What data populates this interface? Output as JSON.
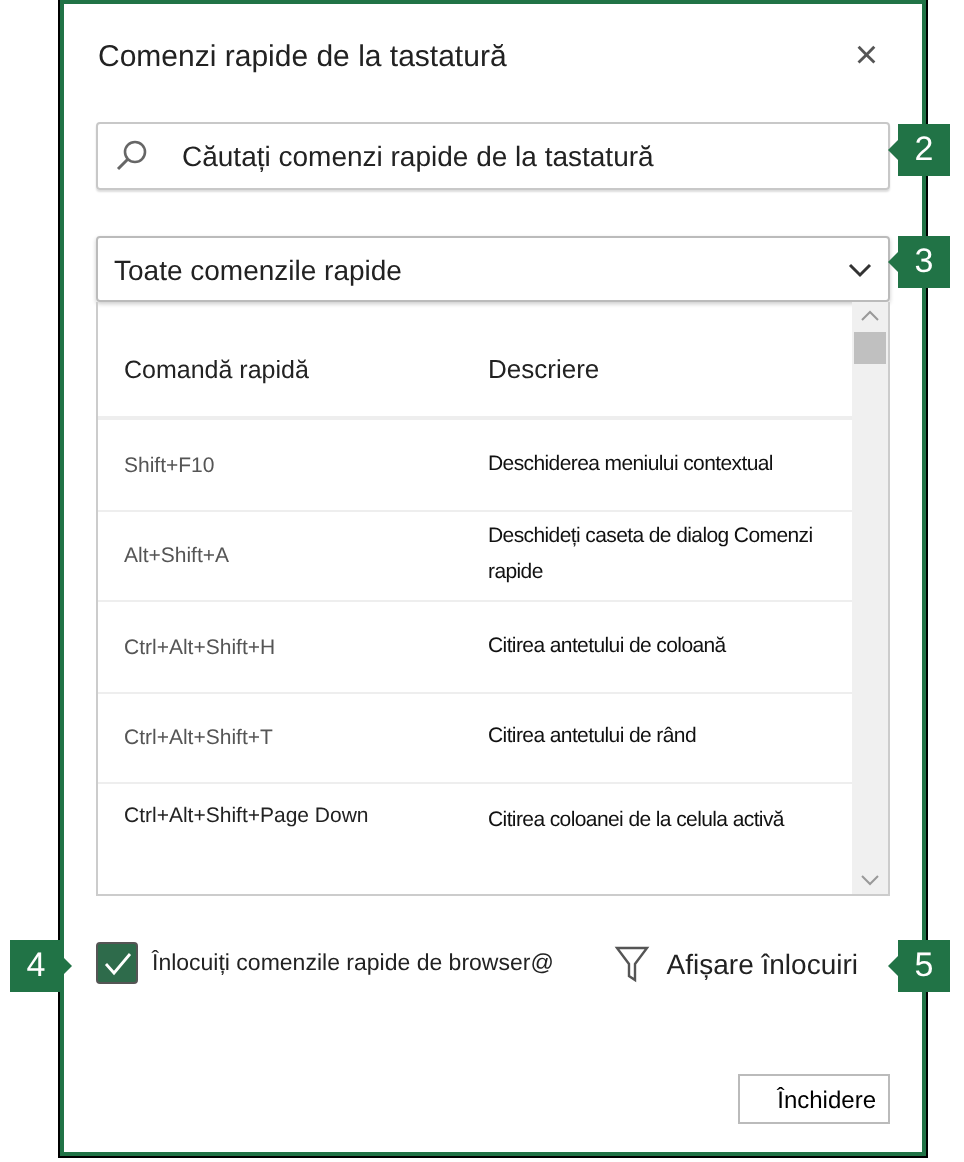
{
  "dialog": {
    "title": "Comenzi rapide de la tastatură",
    "close": "×"
  },
  "search": {
    "placeholder": "Căutați comenzi rapide de la tastatură"
  },
  "filter": {
    "value": "Toate comenzile rapide"
  },
  "table": {
    "columns": [
      "Comandă rapidă",
      "Descriere"
    ],
    "rows": [
      {
        "shortcut": "Shift+F10",
        "description": "Deschiderea meniului contextual"
      },
      {
        "shortcut": "Alt+Shift+A",
        "description": "Deschideți caseta de dialog Comenzi rapide"
      },
      {
        "shortcut": "Ctrl+Alt+Shift+H",
        "description": "Citirea antetului de coloană"
      },
      {
        "shortcut": "Ctrl+Alt+Shift+T",
        "description": "Citirea antetului de rând"
      },
      {
        "shortcut": "Ctrl+Alt+Shift+Page Down",
        "description": "Citirea coloanei de la celula activă"
      }
    ]
  },
  "override": {
    "label": "Înlocuiți comenzile rapide de browser@",
    "checked": true
  },
  "show_overrides": {
    "label": "Afișare înlocuiri"
  },
  "close_button": {
    "label": "Închidere"
  },
  "callouts": [
    "2",
    "3",
    "4",
    "5"
  ]
}
